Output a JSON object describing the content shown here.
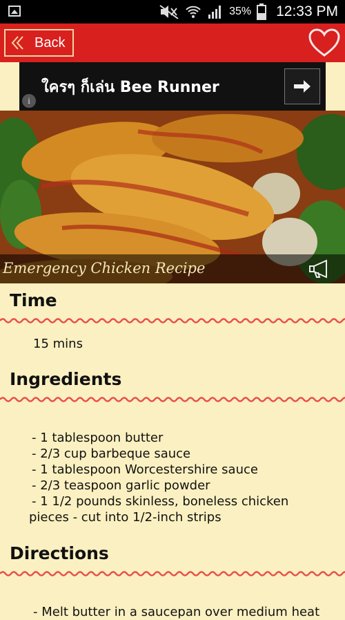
{
  "status": {
    "battery_pct": "35%",
    "time": "12:33 PM"
  },
  "nav": {
    "back_label": "Back"
  },
  "ad": {
    "text": "ใครๆ ก็เล่น Bee Runner",
    "info": "i"
  },
  "recipe": {
    "title": "Emergency Chicken Recipe",
    "time_heading": "Time",
    "time_value": "15 mins",
    "ingredients_heading": "Ingredients",
    "ingredients": [
      "-  1 tablespoon butter",
      "-  2/3 cup barbeque sauce",
      "-  1 tablespoon Worcestershire sauce",
      "-  2/3 teaspoon garlic powder",
      "-  1 1/2 pounds skinless, boneless chicken",
      "pieces - cut into 1/2-inch strips"
    ],
    "directions_heading": "Directions",
    "directions_first": "- Melt butter in a saucepan over medium heat"
  },
  "colors": {
    "bar": "#d8201f",
    "background": "#fbf0c1",
    "wave": "#e8504a",
    "caption_text": "#f3e7b7"
  }
}
